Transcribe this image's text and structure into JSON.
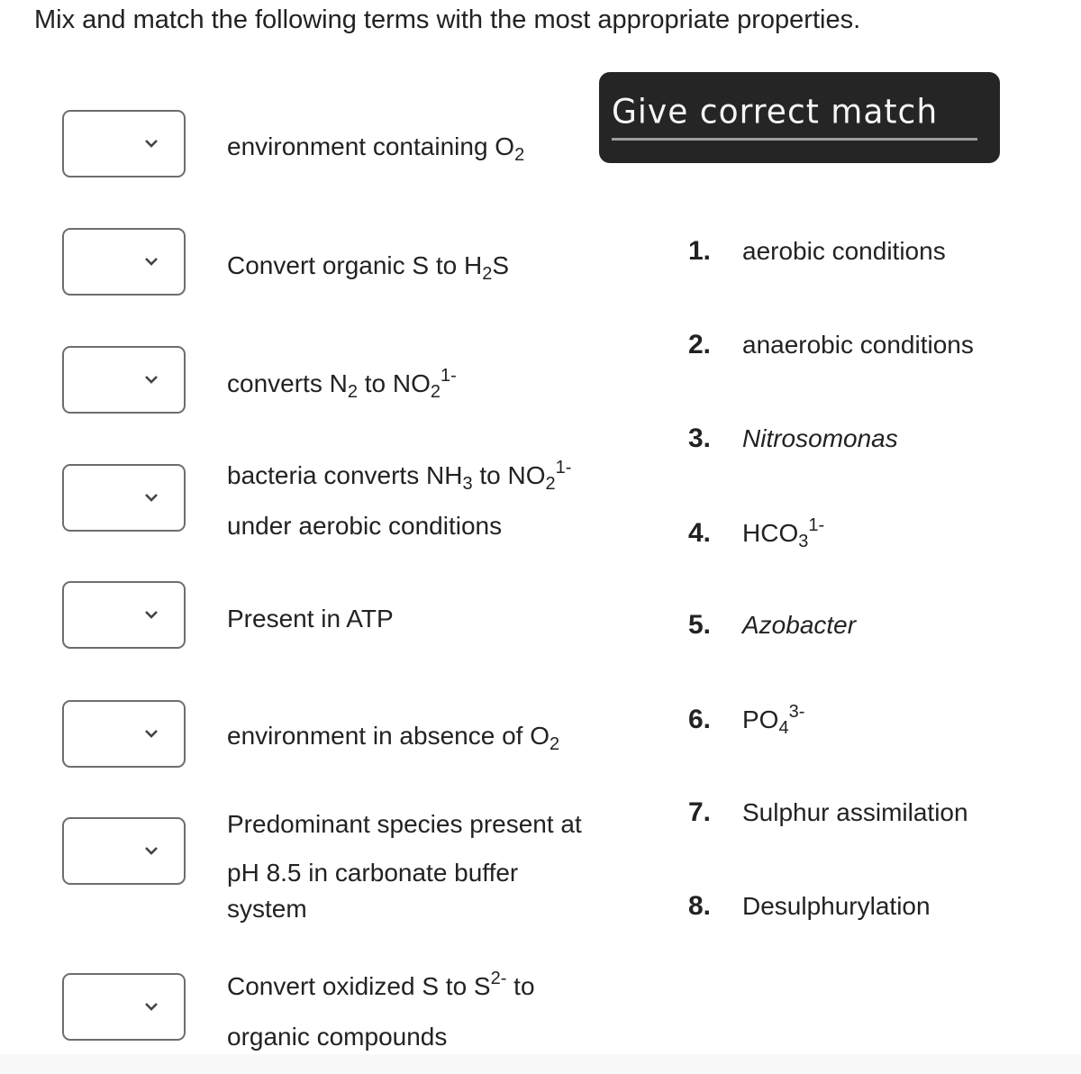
{
  "title": "Mix and match the following terms with the most appropriate properties.",
  "banner": {
    "label": "Give correct match"
  },
  "terms": [
    {
      "parts": [
        "environment containing O",
        "2"
      ]
    },
    {
      "parts": [
        "Convert organic S to H",
        "2",
        "S"
      ]
    },
    {
      "parts": [
        "converts N",
        "2",
        " to NO",
        "2",
        "1-"
      ]
    },
    {
      "line1": [
        "bacteria converts NH",
        "3",
        " to NO",
        "2",
        "1-"
      ],
      "line2": "under aerobic conditions"
    },
    {
      "parts": [
        "Present in ATP"
      ]
    },
    {
      "parts": [
        "environment in absence of O",
        "2"
      ]
    },
    {
      "lines": [
        "Predominant species present at",
        "pH 8.5 in carbonate buffer",
        "system"
      ]
    },
    {
      "line1": [
        "Convert oxidized S to S",
        "2-",
        " to"
      ],
      "line2": "organic compounds"
    }
  ],
  "dropdowns": [
    {
      "selected": ""
    },
    {
      "selected": ""
    },
    {
      "selected": ""
    },
    {
      "selected": ""
    },
    {
      "selected": ""
    },
    {
      "selected": ""
    },
    {
      "selected": ""
    },
    {
      "selected": ""
    }
  ],
  "options": [
    {
      "num": "1.",
      "text": "aerobic conditions"
    },
    {
      "num": "2.",
      "text": "anaerobic conditions"
    },
    {
      "num": "3.",
      "text": "Nitrosomonas"
    },
    {
      "num": "4.",
      "parts": [
        "HCO",
        "3",
        "1-"
      ]
    },
    {
      "num": "5.",
      "text": "Azobacter"
    },
    {
      "num": "6.",
      "parts": [
        "PO",
        "4",
        "3-"
      ]
    },
    {
      "num": "7.",
      "text": "Sulphur assimilation"
    },
    {
      "num": "8.",
      "text": "Desulphurylation"
    }
  ]
}
